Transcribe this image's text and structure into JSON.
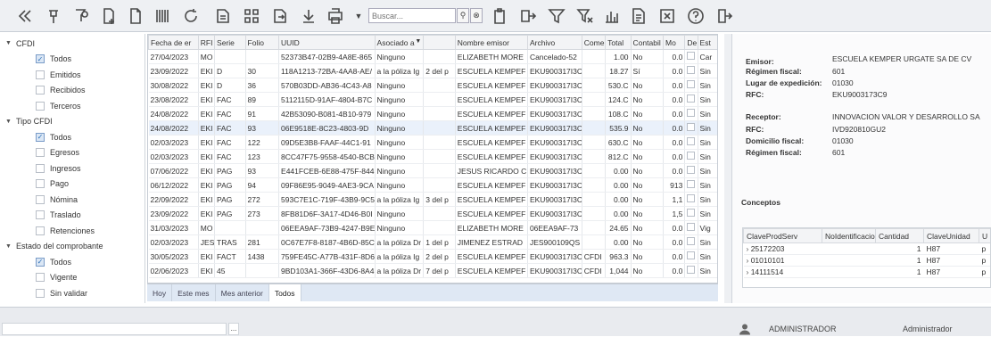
{
  "toolbar": {
    "search_placeholder": "Buscar...",
    "icons": [
      "collapse-left-icon",
      "pin-icon",
      "filter-pin-icon",
      "new-document-icon",
      "blank-document-icon",
      "barcode-icon",
      "refresh-icon",
      "pdf-icon",
      "qr-icon",
      "export-icon",
      "download-icon",
      "print-icon",
      "dropdown-icon",
      "search-icon",
      "clear-search-icon",
      "clipboard-icon",
      "forward-icon",
      "filter-icon",
      "clear-filter-icon",
      "report-icon",
      "document-list-icon",
      "excel-icon",
      "help-icon",
      "exit-icon"
    ]
  },
  "tree": [
    {
      "type": "group",
      "label": "CFDI"
    },
    {
      "type": "item",
      "label": "Todos",
      "checked": true
    },
    {
      "type": "item",
      "label": "Emitidos",
      "checked": false
    },
    {
      "type": "item",
      "label": "Recibidos",
      "checked": false
    },
    {
      "type": "item",
      "label": "Terceros",
      "checked": false
    },
    {
      "type": "group",
      "label": "Tipo CFDI"
    },
    {
      "type": "item",
      "label": "Todos",
      "checked": true
    },
    {
      "type": "item",
      "label": "Egresos",
      "checked": false
    },
    {
      "type": "item",
      "label": "Ingresos",
      "checked": false
    },
    {
      "type": "item",
      "label": "Pago",
      "checked": false
    },
    {
      "type": "item",
      "label": "Nómina",
      "checked": false
    },
    {
      "type": "item",
      "label": "Traslado",
      "checked": false
    },
    {
      "type": "item",
      "label": "Retenciones",
      "checked": false
    },
    {
      "type": "group",
      "label": "Estado del comprobante"
    },
    {
      "type": "item",
      "label": "Todos",
      "checked": true
    },
    {
      "type": "item",
      "label": "Vigente",
      "checked": false
    },
    {
      "type": "item",
      "label": "Sin validar",
      "checked": false
    }
  ],
  "grid": {
    "columns": [
      "Fecha de er",
      "RFI",
      "Serie",
      "Folio",
      "UUID",
      "Asociado a",
      "",
      "Nombre emisor",
      "Archivo",
      "Come",
      "Total",
      "Contabil",
      "Mo",
      "De",
      "Est"
    ],
    "selected_row": 5,
    "rows": [
      [
        "27/04/2023",
        "MO",
        "",
        "",
        "52373B47-02B9-4A8E-865",
        "Ninguno",
        "",
        "ELIZABETH MORE",
        "Cancelado-52",
        "",
        "1.00",
        "No",
        "0.0",
        "",
        "Car"
      ],
      [
        "23/09/2022",
        "EKI",
        "D",
        "30",
        "118A1213-72BA-4AA8-AE/",
        "a la póliza Ig",
        "2 del p",
        "ESCUELA KEMPEF",
        "EKU900317I3C",
        "",
        "18.27",
        "Sí",
        "0.0",
        "",
        "Sin"
      ],
      [
        "30/08/2022",
        "EKI",
        "D",
        "36",
        "570B03DD-AB36-4C43-A8",
        "Ninguno",
        "",
        "ESCUELA KEMPEF",
        "EKU900317I3C",
        "",
        "530.C",
        "No",
        "0.0",
        "",
        "Sin"
      ],
      [
        "23/08/2022",
        "EKI",
        "FAC",
        "89",
        "5112115D-91AF-4804-B7C",
        "Ninguno",
        "",
        "ESCUELA KEMPEF",
        "EKU900317I3C",
        "",
        "124.C",
        "No",
        "0.0",
        "",
        "Sin"
      ],
      [
        "24/08/2022",
        "EKI",
        "FAC",
        "91",
        "42B53090-B081-4B10-979",
        "Ninguno",
        "",
        "ESCUELA KEMPEF",
        "EKU900317I3C",
        "",
        "108.C",
        "No",
        "0.0",
        "",
        "Sin"
      ],
      [
        "24/08/2022",
        "EKI",
        "FAC",
        "93",
        "06E9518E-8C23-4803-9D",
        "Ninguno",
        "",
        "ESCUELA KEMPEF",
        "EKU900317I3C",
        "",
        "535.9",
        "No",
        "0.0",
        "",
        "Sin"
      ],
      [
        "02/03/2023",
        "EKI",
        "FAC",
        "122",
        "09D5E3B8-FAAF-44C1-91",
        "Ninguno",
        "",
        "ESCUELA KEMPEF",
        "EKU900317I3C",
        "",
        "630.C",
        "No",
        "0.0",
        "",
        "Sin"
      ],
      [
        "02/03/2023",
        "EKI",
        "FAC",
        "123",
        "8CC47F75-9558-4540-BCB",
        "Ninguno",
        "",
        "ESCUELA KEMPEF",
        "EKU900317I3C",
        "",
        "812.C",
        "No",
        "0.0",
        "",
        "Sin"
      ],
      [
        "07/06/2022",
        "EKI",
        "PAG",
        "93",
        "E441FCEB-6E88-475F-844",
        "Ninguno",
        "",
        "JESUS RICARDO C",
        "EKU900317I3C",
        "",
        "0.00",
        "No",
        "0.0",
        "",
        "Sin"
      ],
      [
        "06/12/2022",
        "EKI",
        "PAG",
        "94",
        "09F86E95-9049-4AE3-9CA",
        "Ninguno",
        "",
        "ESCUELA KEMPEF",
        "EKU900317I3C",
        "",
        "0.00",
        "No",
        "913",
        "",
        "Sin"
      ],
      [
        "22/09/2022",
        "EKI",
        "PAG",
        "272",
        "593C7E1C-719F-43B9-9C5",
        "a la póliza Ig",
        "3 del p",
        "ESCUELA KEMPEF",
        "EKU900317I3C",
        "",
        "0.00",
        "No",
        "1,1",
        "",
        "Sin"
      ],
      [
        "23/09/2022",
        "EKI",
        "PAG",
        "273",
        "8FB81D6F-3A17-4D46-B0I",
        "Ninguno",
        "",
        "ESCUELA KEMPEF",
        "EKU900317I3C",
        "",
        "0.00",
        "No",
        "1,5",
        "",
        "Sin"
      ],
      [
        "31/03/2023",
        "MO",
        "",
        "",
        "06EEA9AF-73B9-4247-B9E",
        "Ninguno",
        "",
        "ELIZABETH MORE",
        "06EEA9AF-73",
        "",
        "24.65",
        "No",
        "0.0",
        "",
        "Vig"
      ],
      [
        "02/03/2023",
        "JES",
        "TRAS",
        "281",
        "0C67E7F8-8187-4B6D-85C",
        "a la póliza Dr",
        "1 del p",
        "JIMENEZ ESTRAD",
        "JES900109QS",
        "",
        "0.00",
        "No",
        "0.0",
        "",
        "Sin"
      ],
      [
        "30/05/2023",
        "EKI",
        "FACT",
        "1438",
        "759FE45C-A77B-431F-8D6",
        "a la póliza Ig",
        "2 del p",
        "ESCUELA KEMPEF",
        "EKU900317I3C",
        "CFDI",
        "963.3",
        "No",
        "0.0",
        "",
        "Sin"
      ],
      [
        "02/06/2023",
        "EKI",
        "45",
        "",
        "9BD103A1-366F-43D6-8A4",
        "a la póliza Dr",
        "7 del p",
        "ESCUELA KEMPEF",
        "EKU900317I3C",
        "CFDI",
        "1,044",
        "No",
        "0.0",
        "",
        "Sin"
      ]
    ]
  },
  "tabs": [
    "Hoy",
    "Este mes",
    "Mes anterior",
    "Todos"
  ],
  "active_tab": 3,
  "detail": {
    "emisor_label": "Emisor:",
    "emisor_value": "ESCUELA KEMPER URGATE SA DE CV",
    "regimen_label": "Régimen fiscal:",
    "regimen_value": "601",
    "lugar_label": "Lugar de expedición:",
    "lugar_value": "01030",
    "rfc_label": "RFC:",
    "rfc_value": "EKU9003173C9",
    "receptor_label": "Receptor:",
    "receptor_value": "INNOVACION VALOR Y DESARROLLO SA",
    "rfc2_label": "RFC:",
    "rfc2_value": "IVD920810GU2",
    "domicilio_label": "Domicilio fiscal:",
    "domicilio_value": "01030",
    "regimen2_label": "Régimen fiscal:",
    "regimen2_value": "601",
    "conceptos_title": "Conceptos"
  },
  "conceptos": {
    "columns": [
      "ClaveProdServ",
      "NoIdentificacio",
      "Cantidad",
      "ClaveUnidad",
      "U"
    ],
    "rows": [
      [
        "25172203",
        "",
        "1",
        "H87",
        "p"
      ],
      [
        "01010101",
        "",
        "1",
        "H87",
        "p"
      ],
      [
        "14111514",
        "",
        "1",
        "H87",
        "p"
      ]
    ]
  },
  "status": {
    "user_upper": "ADMINISTRADOR",
    "user": "Administrador",
    "ellipsis": "..."
  }
}
